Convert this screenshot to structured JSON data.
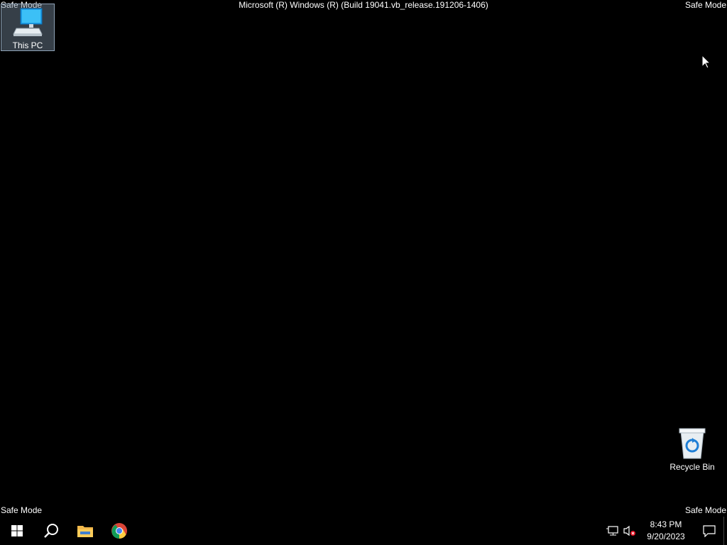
{
  "watermark": {
    "top_left": "Safe Mode",
    "top_right": "Safe Mode",
    "bottom_left": "Safe Mode",
    "bottom_right": "Safe Mode",
    "build": "Microsoft (R) Windows (R) (Build 19041.vb_release.191206-1406)"
  },
  "desktop": {
    "icons": [
      {
        "label": "This PC",
        "icon": "computer-icon",
        "selected": true
      },
      {
        "label": "Recycle Bin",
        "icon": "recycle-bin-icon",
        "selected": false
      }
    ]
  },
  "taskbar": {
    "buttons": [
      {
        "name": "start",
        "icon": "windows-logo-icon"
      },
      {
        "name": "search",
        "icon": "search-icon"
      },
      {
        "name": "file-explorer",
        "icon": "folder-icon"
      },
      {
        "name": "chrome",
        "icon": "chrome-icon"
      }
    ],
    "tray": {
      "time": "8:43 PM",
      "date": "9/20/2023",
      "icons": [
        "network-icon",
        "volume-muted-icon",
        "notification-icon"
      ]
    }
  },
  "colors": {
    "background": "#000000",
    "accent": "#0078d7",
    "selection": "#8ea2b6"
  }
}
